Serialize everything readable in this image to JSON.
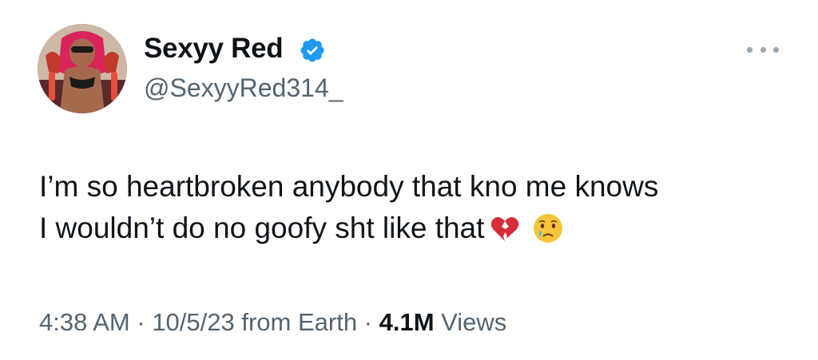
{
  "author": {
    "display_name": "Sexyy Red",
    "handle": "@SexyyRed314_",
    "verified": true
  },
  "tweet": {
    "line1": "I’m so heartbroken anybody that kno me knows",
    "line2": "I wouldn’t do no goofy sht like that",
    "emojis": [
      "broken-heart-emoji",
      "crying-face-emoji"
    ]
  },
  "meta": {
    "time": "4:38 AM",
    "sep1": " · ",
    "date": "10/5/23 from Earth",
    "sep2": " · ",
    "views_count": "4.1M",
    "views_label": " Views"
  },
  "colors": {
    "text": "#0f1419",
    "secondary": "#536471",
    "verified_blue": "#1d9bf0"
  }
}
